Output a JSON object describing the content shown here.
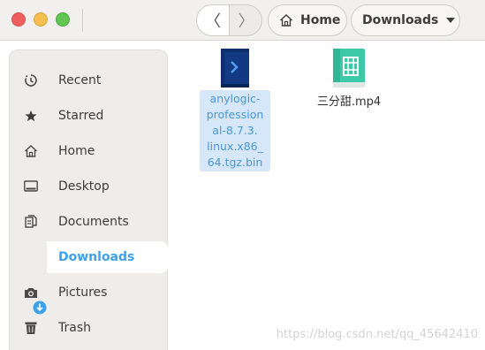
{
  "header": {
    "back_glyph": "〈",
    "forward_glyph": "〉",
    "breadcrumbs": [
      {
        "label": "Home",
        "icon": "home-icon"
      },
      {
        "label": "Downloads",
        "icon": "chevron-down-icon"
      }
    ]
  },
  "sidebar": {
    "items": [
      {
        "label": "Recent",
        "icon": "recent-icon"
      },
      {
        "label": "Starred",
        "icon": "star-icon"
      },
      {
        "label": "Home",
        "icon": "home-icon"
      },
      {
        "label": "Desktop",
        "icon": "desktop-icon"
      },
      {
        "label": "Documents",
        "icon": "documents-icon"
      },
      {
        "label": "Downloads",
        "icon": "download-icon",
        "active": true
      },
      {
        "label": "Pictures",
        "icon": "camera-icon"
      },
      {
        "label": "Trash",
        "icon": "trash-icon"
      }
    ]
  },
  "files": [
    {
      "name": "anylogic-professional-8.7.3.linux.x86_64.tgz.bin",
      "name_lines": [
        "anylogic-",
        "profession",
        "al-8.7.3.",
        "linux.x86_",
        "64.tgz.bin"
      ],
      "icon": "executable-icon",
      "selected": true
    },
    {
      "name": "三分甜.mp4",
      "icon": "video-file-icon",
      "selected": false
    }
  ],
  "watermark": "https://blog.csdn.net/qq_45642410",
  "colors": {
    "accent": "#3ea1e8",
    "selection_bg": "#d5e7f8",
    "close": "#ec5f5d",
    "minimize": "#f4bf4f",
    "maximize": "#61c454"
  }
}
